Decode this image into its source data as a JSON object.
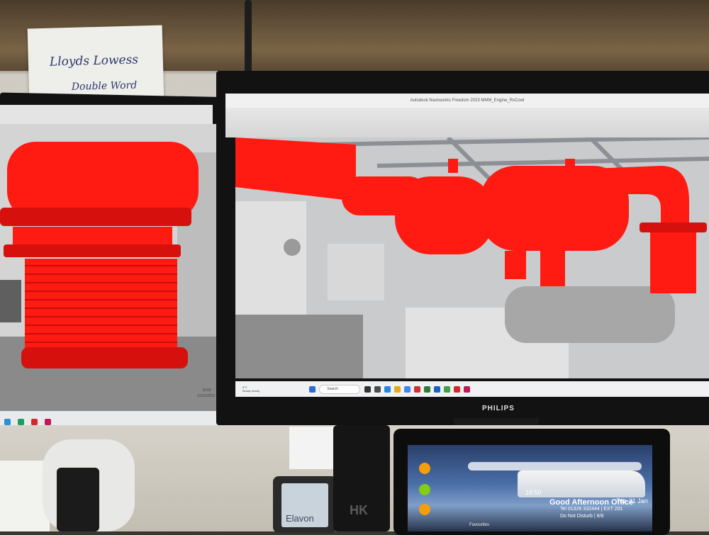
{
  "scene": "photo of two monitors showing a red engine exhaust model over a grey point-cloud scan, above a desk with a phone and tablet",
  "wall_note": {
    "line1": "Lloyds Lowess",
    "line2": "Double Word"
  },
  "right_monitor": {
    "title_bar": "Autodesk Navisworks Freedom 2023   MMM_Engine_RsCowl",
    "brand": "PHILIPS",
    "taskbar": {
      "weather_line1": "8°C",
      "weather_line2": "Mostly cloudy",
      "search_label": "Search"
    }
  },
  "left_monitor": {
    "tray_time": "16:50",
    "tray_date": "31/01/2023"
  },
  "desk_phone": {
    "logo": "HK"
  },
  "pos_terminal": {
    "brand": "Elavon"
  },
  "tablet": {
    "clock": "16:50",
    "date": "Tue 31 Jan",
    "greeting": "Good Afternoon Office",
    "line1": "Tel 01326 332444 | EXT 201",
    "line2": "Do Not Disturb | 8/8",
    "favourites_label": "Favourites"
  },
  "colors": {
    "model_red": "#ff1a12",
    "model_red_dark": "#c70e0a",
    "point_cloud_grey": "#b9b9b9"
  }
}
